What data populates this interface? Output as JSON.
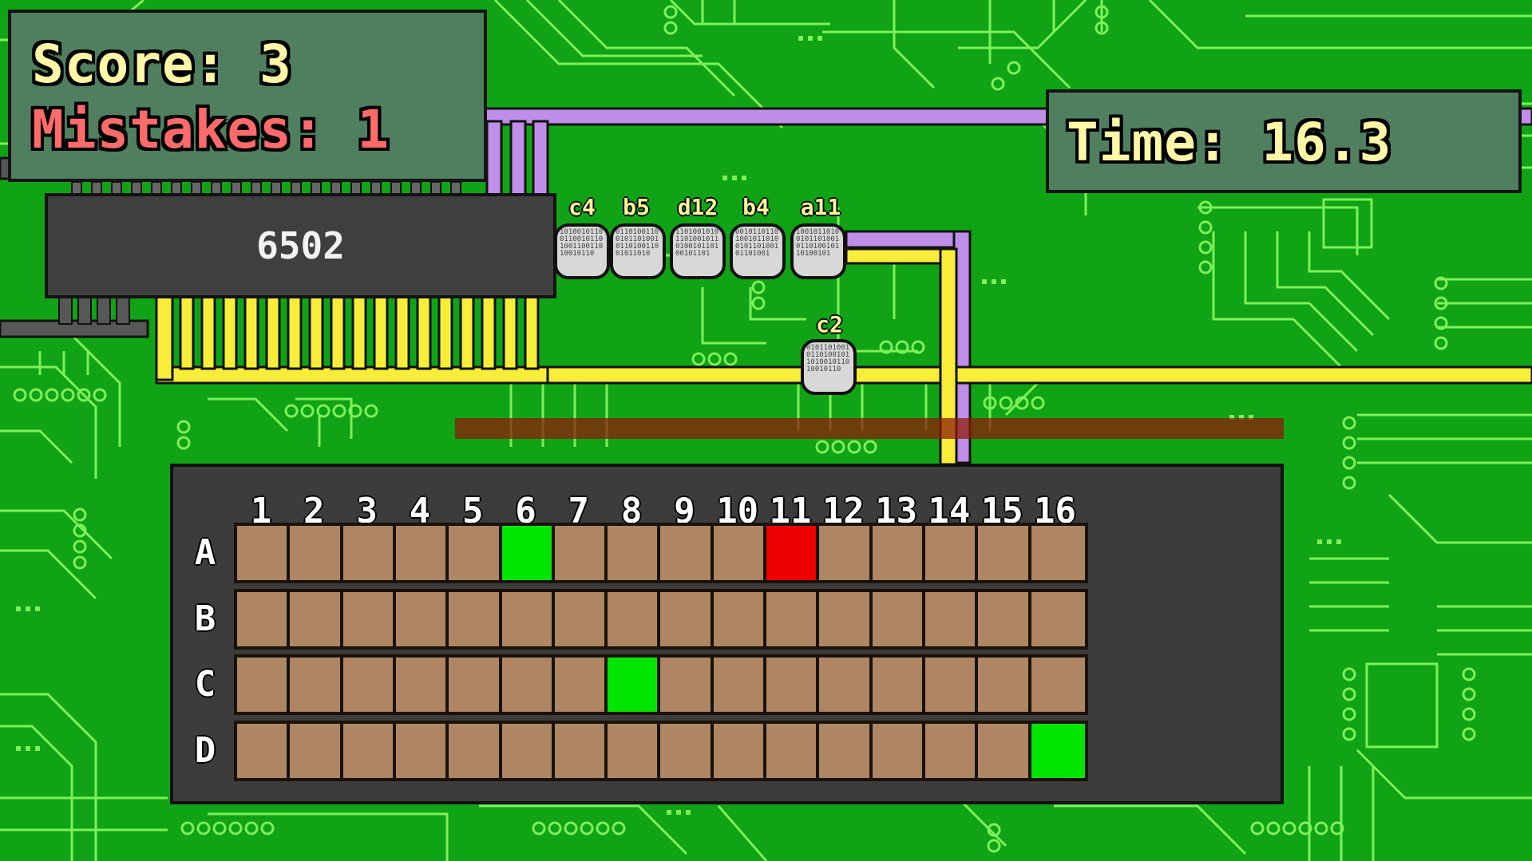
{
  "hud": {
    "score_label": "Score: 3",
    "mistakes_label": "Mistakes: 1",
    "time_label": "Time: 16.3"
  },
  "cpu": {
    "label": "6502"
  },
  "packets": [
    {
      "label": "c4"
    },
    {
      "label": "b5"
    },
    {
      "label": "d12"
    },
    {
      "label": "b4"
    },
    {
      "label": "a11"
    },
    {
      "label": "c2"
    }
  ],
  "grid": {
    "columns": [
      "1",
      "2",
      "3",
      "4",
      "5",
      "6",
      "7",
      "8",
      "9",
      "10",
      "11",
      "12",
      "13",
      "14",
      "15",
      "16"
    ],
    "rows": [
      "A",
      "B",
      "C",
      "D"
    ],
    "cell_states": [
      [
        "empty",
        "empty",
        "empty",
        "empty",
        "empty",
        "correct",
        "empty",
        "empty",
        "empty",
        "empty",
        "wrong",
        "empty",
        "empty",
        "empty",
        "empty",
        "empty"
      ],
      [
        "empty",
        "empty",
        "empty",
        "empty",
        "empty",
        "empty",
        "empty",
        "empty",
        "empty",
        "empty",
        "empty",
        "empty",
        "empty",
        "empty",
        "empty",
        "empty"
      ],
      [
        "empty",
        "empty",
        "empty",
        "empty",
        "empty",
        "empty",
        "empty",
        "correct",
        "empty",
        "empty",
        "empty",
        "empty",
        "empty",
        "empty",
        "empty",
        "empty"
      ],
      [
        "empty",
        "empty",
        "empty",
        "empty",
        "empty",
        "empty",
        "empty",
        "empty",
        "empty",
        "empty",
        "empty",
        "empty",
        "empty",
        "empty",
        "empty",
        "correct"
      ]
    ]
  },
  "colors": {
    "board": "#10a316",
    "trace": "#7ef05a",
    "bus_yellow": "#f8ee3a",
    "bus_purple": "#bf8ee8",
    "cell_empty": "#ae8663",
    "cell_correct": "#00e600",
    "cell_wrong": "#ee0000"
  }
}
